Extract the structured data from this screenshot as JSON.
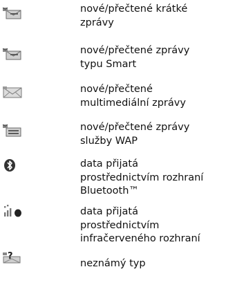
{
  "legend": {
    "items": [
      {
        "icon": "sms-envelope-icon",
        "lines": [
          "nové/přečtené krátké",
          "zprávy"
        ]
      },
      {
        "icon": "smart-message-icon",
        "lines": [
          "nové/přečtené zprávy",
          "typu Smart"
        ]
      },
      {
        "icon": "mms-envelope-icon",
        "lines": [
          "nové/přečtené",
          "multimediální zprávy"
        ]
      },
      {
        "icon": "wap-message-icon",
        "lines": [
          "nové/přečtené zprávy",
          "služby WAP"
        ]
      },
      {
        "icon": "bluetooth-icon",
        "lines": [
          "data přijatá",
          "prostřednictvím rozhraní",
          "Bluetooth™"
        ]
      },
      {
        "icon": "infrared-icon",
        "lines": [
          "data přijatá",
          "prostřednictvím",
          "infračerveného rozhraní"
        ]
      },
      {
        "icon": "unknown-type-icon",
        "lines": [
          "neznámý typ"
        ]
      }
    ]
  }
}
